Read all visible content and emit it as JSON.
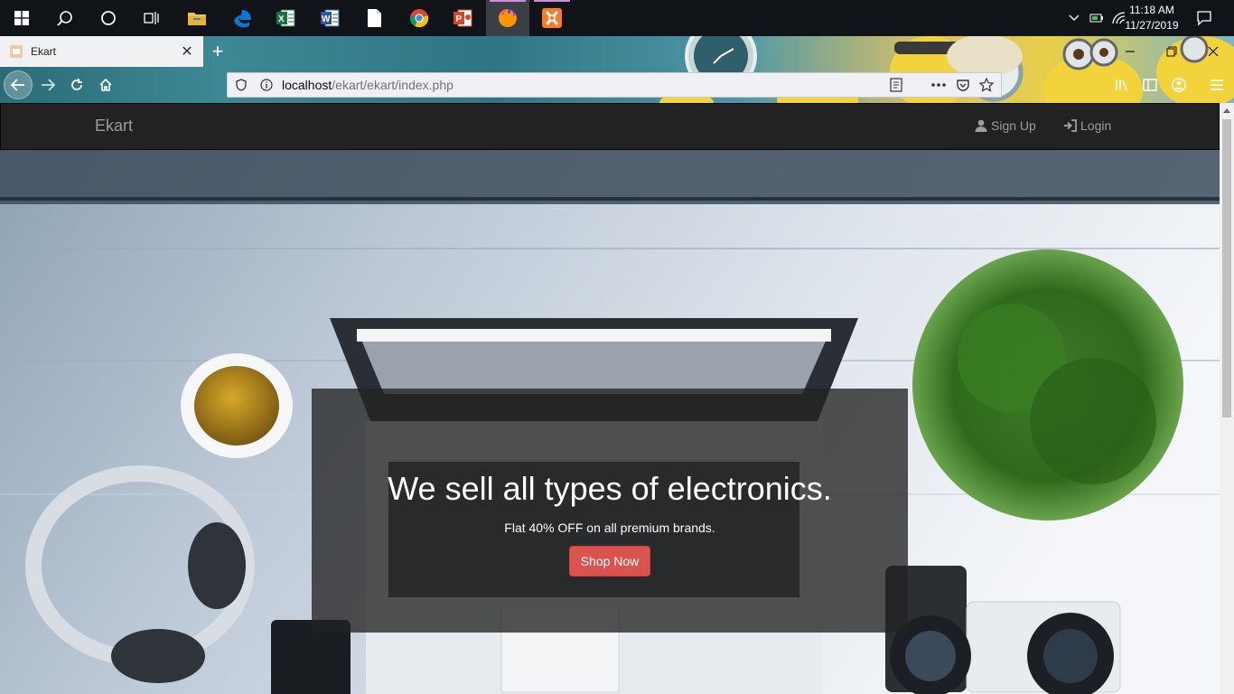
{
  "taskbar": {
    "clock_time": "11:18 AM",
    "clock_date": "11/27/2019",
    "apps": [
      "start-icon",
      "search-icon",
      "cortana-icon",
      "task-view-icon",
      "file-explorer-icon",
      "edge-icon",
      "excel-icon",
      "word-icon",
      "file-icon",
      "chrome-icon",
      "powerpoint-icon",
      "firefox-icon",
      "xampp-icon"
    ]
  },
  "browser": {
    "tab_title": "Ekart",
    "url_host": "localhost",
    "url_path": "/ekart/ekart/index.php",
    "accent": "#d9534f"
  },
  "navbar": {
    "brand": "Ekart",
    "signup_label": "Sign Up",
    "login_label": "Login"
  },
  "hero": {
    "heading": "We sell all types of electronics.",
    "subheading": "Flat 40% OFF on all premium brands.",
    "button_label": "Shop Now"
  }
}
